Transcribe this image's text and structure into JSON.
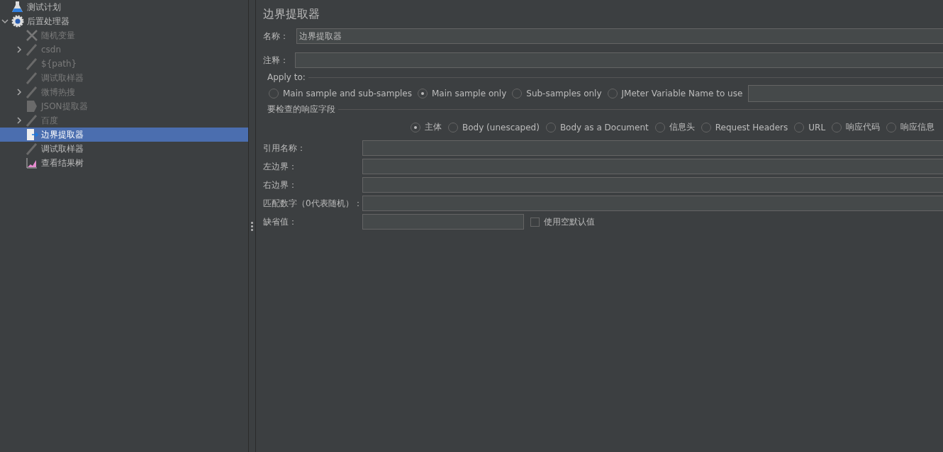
{
  "tree": {
    "label": "测试计划",
    "kind": "plan",
    "disabled": false,
    "selected": false,
    "children": [
      {
        "label": "后置处理器",
        "kind": "gear",
        "disabled": false,
        "selected": false,
        "expanded": true,
        "children": [
          {
            "label": "随机变量",
            "kind": "tools",
            "disabled": true,
            "selected": false
          },
          {
            "label": "csdn",
            "kind": "pen",
            "disabled": true,
            "selected": false,
            "expanded": false
          },
          {
            "label": "${path}",
            "kind": "pen",
            "disabled": true,
            "selected": false
          },
          {
            "label": "调试取样器",
            "kind": "pen",
            "disabled": true,
            "selected": false
          },
          {
            "label": "微博热搜",
            "kind": "pen",
            "disabled": true,
            "selected": false,
            "expanded": false
          },
          {
            "label": "JSON提取器",
            "kind": "doc",
            "disabled": true,
            "selected": false
          },
          {
            "label": "百度",
            "kind": "pen",
            "disabled": true,
            "selected": false,
            "expanded": false
          },
          {
            "label": "边界提取器",
            "kind": "extract",
            "disabled": false,
            "selected": true
          },
          {
            "label": "调试取样器",
            "kind": "pen",
            "disabled": false,
            "selected": false
          },
          {
            "label": "查看结果树",
            "kind": "chart",
            "disabled": false,
            "selected": false
          }
        ]
      }
    ]
  },
  "panel": {
    "title": "边界提取器",
    "name_field": {
      "label": "名称：",
      "value": "边界提取器"
    },
    "comment_field": {
      "label": "注释："
    },
    "apply_to": {
      "legend": "Apply to:",
      "options": [
        {
          "label": "Main sample and sub-samples",
          "selected": false
        },
        {
          "label": "Main sample only",
          "selected": true
        },
        {
          "label": "Sub-samples only",
          "selected": false
        },
        {
          "label": "JMeter Variable Name to use",
          "selected": false
        }
      ]
    },
    "response_field": {
      "legend": "要检查的响应字段",
      "options": [
        {
          "label": "主体",
          "selected": true
        },
        {
          "label": "Body (unescaped)",
          "selected": false
        },
        {
          "label": "Body as a Document",
          "selected": false
        },
        {
          "label": "信息头",
          "selected": false
        },
        {
          "label": "Request Headers",
          "selected": false
        },
        {
          "label": "URL",
          "selected": false
        },
        {
          "label": "响应代码",
          "selected": false
        },
        {
          "label": "响应信息",
          "selected": false
        }
      ]
    },
    "fields": [
      {
        "label": "引用名称："
      },
      {
        "label": "左边界："
      },
      {
        "label": "右边界："
      },
      {
        "label": "匹配数字（0代表随机）："
      }
    ],
    "default_value": {
      "label": "缺省值：",
      "checkbox_label": "使用空默认值",
      "checked": false
    }
  }
}
